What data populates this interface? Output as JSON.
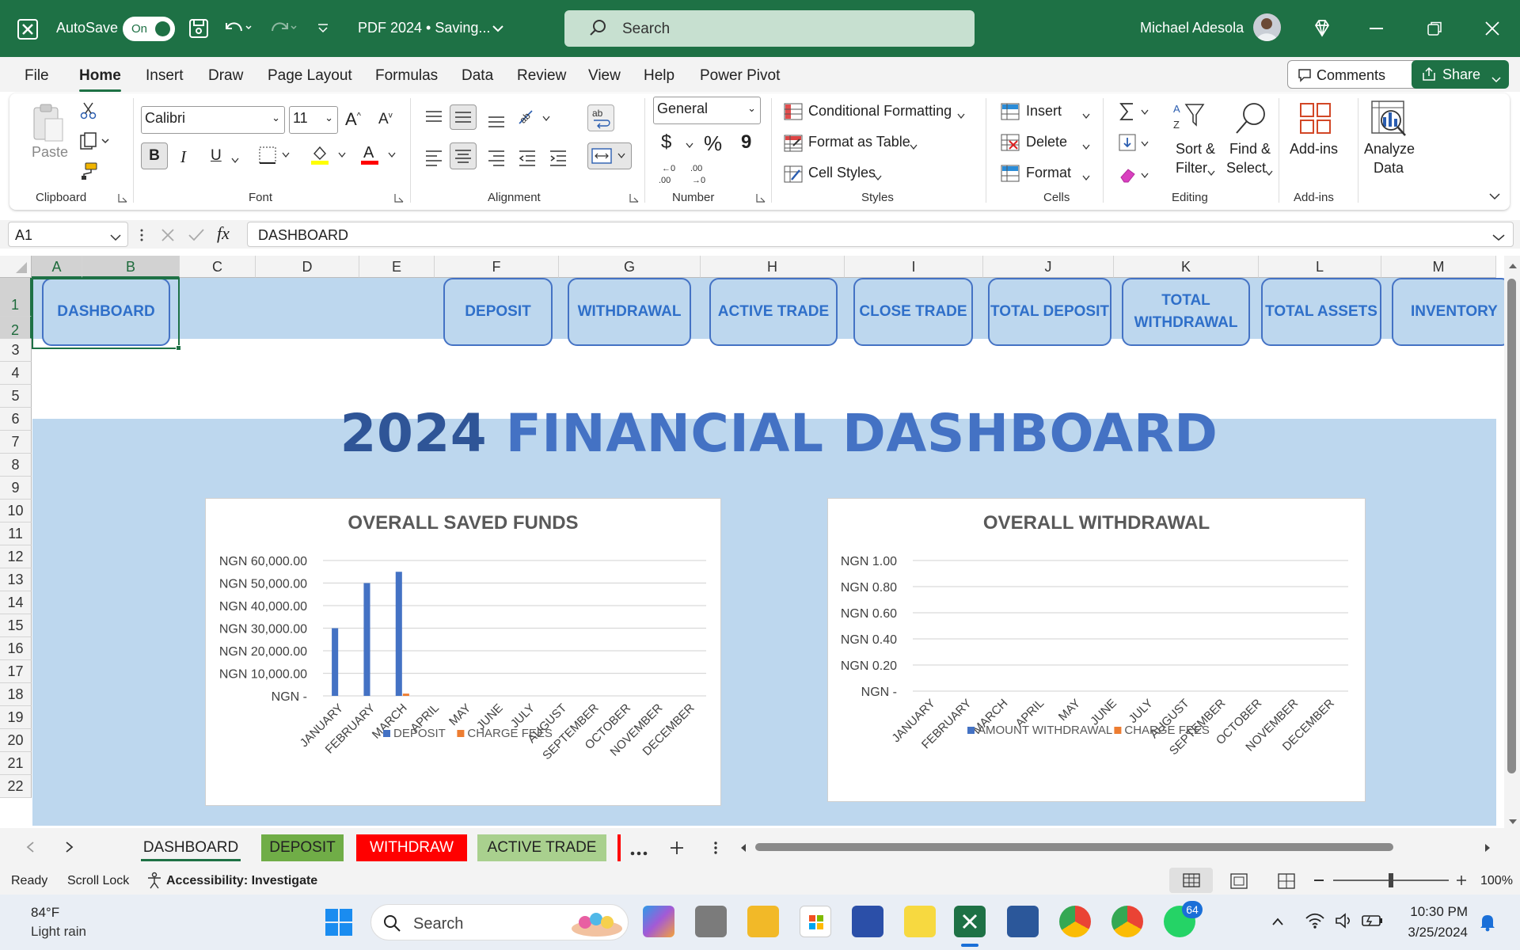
{
  "titlebar": {
    "autosave_label": "AutoSave",
    "autosave_state": "On",
    "doc_title": "PDF 2024 • Saving...",
    "search_placeholder": "Search",
    "user_name": "Michael Adesola"
  },
  "menu": {
    "items": [
      "File",
      "Home",
      "Insert",
      "Draw",
      "Page Layout",
      "Formulas",
      "Data",
      "Review",
      "View",
      "Help",
      "Power Pivot"
    ],
    "comments_label": "Comments",
    "share_label": "Share"
  },
  "ribbon": {
    "clipboard": {
      "paste": "Paste",
      "label": "Clipboard"
    },
    "font": {
      "name": "Calibri",
      "size": "11",
      "label": "Font",
      "bold": "B",
      "italic": "I",
      "underline": "U"
    },
    "alignment": {
      "label": "Alignment"
    },
    "number": {
      "format": "General",
      "label": "Number",
      "currency": "$",
      "percent": "%",
      "comma": "9"
    },
    "styles": {
      "conditional": "Conditional Formatting",
      "format_table": "Format as Table",
      "cell_styles": "Cell Styles",
      "label": "Styles"
    },
    "cells": {
      "insert": "Insert",
      "delete": "Delete",
      "format": "Format",
      "label": "Cells"
    },
    "editing": {
      "sort_filter_1": "Sort &",
      "sort_filter_2": "Filter",
      "find_select_1": "Find &",
      "find_select_2": "Select",
      "label": "Editing"
    },
    "addins": {
      "addins": "Add-ins",
      "label": "Add-ins",
      "analyze_1": "Analyze",
      "analyze_2": "Data"
    }
  },
  "formula_bar": {
    "name_box": "A1",
    "fx": "fx",
    "content": "DASHBOARD"
  },
  "columns": [
    "A",
    "B",
    "C",
    "D",
    "E",
    "F",
    "G",
    "H",
    "I",
    "J",
    "K",
    "L",
    "M"
  ],
  "rows": [
    "1",
    "2",
    "3",
    "4",
    "5",
    "6",
    "7",
    "8",
    "9",
    "10",
    "11",
    "12",
    "13",
    "14",
    "15",
    "16",
    "17",
    "18",
    "19",
    "20",
    "21",
    "22"
  ],
  "nav_buttons": {
    "dashboard": "DASHBOARD",
    "deposit": "DEPOSIT",
    "withdrawal": "WITHDRAWAL",
    "active_trade": "ACTIVE TRADE",
    "close_trade": "CLOSE TRADE",
    "total_deposit": "TOTAL DEPOSIT",
    "total_withdrawal_1": "TOTAL",
    "total_withdrawal_2": "WITHDRAWAL",
    "total_assets": "TOTAL ASSETS",
    "inventory": "INVENTORY"
  },
  "banner": {
    "year": "2024",
    "title": "FINANCIAL DASHBOARD"
  },
  "chart_data": [
    {
      "type": "bar",
      "title": "OVERALL SAVED FUNDS",
      "categories": [
        "JANUARY",
        "FEBRUARY",
        "MARCH",
        "APRIL",
        "MAY",
        "JUNE",
        "JULY",
        "AUGUST",
        "SEPTEMBER",
        "OCTOBER",
        "NOVEMBER",
        "DECEMBER"
      ],
      "series": [
        {
          "name": "DEPOSIT",
          "color": "#4472c4",
          "values": [
            30000,
            50000,
            55000,
            0,
            0,
            0,
            0,
            0,
            0,
            0,
            0,
            0
          ]
        },
        {
          "name": "CHARGE FEES",
          "color": "#ed7d31",
          "values": [
            0,
            0,
            1000,
            0,
            0,
            0,
            0,
            0,
            0,
            0,
            0,
            0
          ]
        }
      ],
      "ylim": [
        0,
        60000
      ],
      "yticks": [
        "NGN -",
        "NGN 10,000.00",
        "NGN 20,000.00",
        "NGN 30,000.00",
        "NGN 40,000.00",
        "NGN 50,000.00",
        "NGN 60,000.00"
      ],
      "legend": "bottom",
      "grid": true
    },
    {
      "type": "bar",
      "title": "OVERALL WITHDRAWAL",
      "categories": [
        "JANUARY",
        "FEBRUARY",
        "MARCH",
        "APRIL",
        "MAY",
        "JUNE",
        "JULY",
        "AUGUST",
        "SEPTEMBER",
        "OCTOBER",
        "NOVEMBER",
        "DECEMBER"
      ],
      "series": [
        {
          "name": "AMOUNT WITHDRAWAL",
          "color": "#4472c4",
          "values": [
            0,
            0,
            0,
            0,
            0,
            0,
            0,
            0,
            0,
            0,
            0,
            0
          ]
        },
        {
          "name": "CHARGE FEES",
          "color": "#ed7d31",
          "values": [
            0,
            0,
            0,
            0,
            0,
            0,
            0,
            0,
            0,
            0,
            0,
            0
          ]
        }
      ],
      "ylim": [
        0,
        1
      ],
      "yticks": [
        "NGN -",
        "NGN 0.20",
        "NGN 0.40",
        "NGN 0.60",
        "NGN 0.80",
        "NGN 1.00"
      ],
      "legend": "bottom",
      "grid": true
    }
  ],
  "sheet_tabs": [
    {
      "label": "DASHBOARD",
      "bg": "#ffffff",
      "fg": "#222222"
    },
    {
      "label": "DEPOSIT",
      "bg": "#70ad47",
      "fg": "#1a1a1a"
    },
    {
      "label": "WITHDRAW",
      "bg": "#ff0000",
      "fg": "#ffffff"
    },
    {
      "label": "ACTIVE TRADE",
      "bg": "#a9d08e",
      "fg": "#1a1a1a"
    }
  ],
  "status": {
    "ready": "Ready",
    "scroll_lock": "Scroll Lock",
    "accessibility": "Accessibility: Investigate",
    "zoom": "100%"
  },
  "taskbar": {
    "weather_temp": "84°F",
    "weather_desc": "Light rain",
    "search": "Search",
    "whatsapp_badge": "64",
    "time": "10:30 PM",
    "date": "3/25/2024"
  },
  "colors": {
    "excel_green": "#1e7145",
    "band_blue": "#bdd7ee",
    "title_blue": "#4472c4"
  }
}
